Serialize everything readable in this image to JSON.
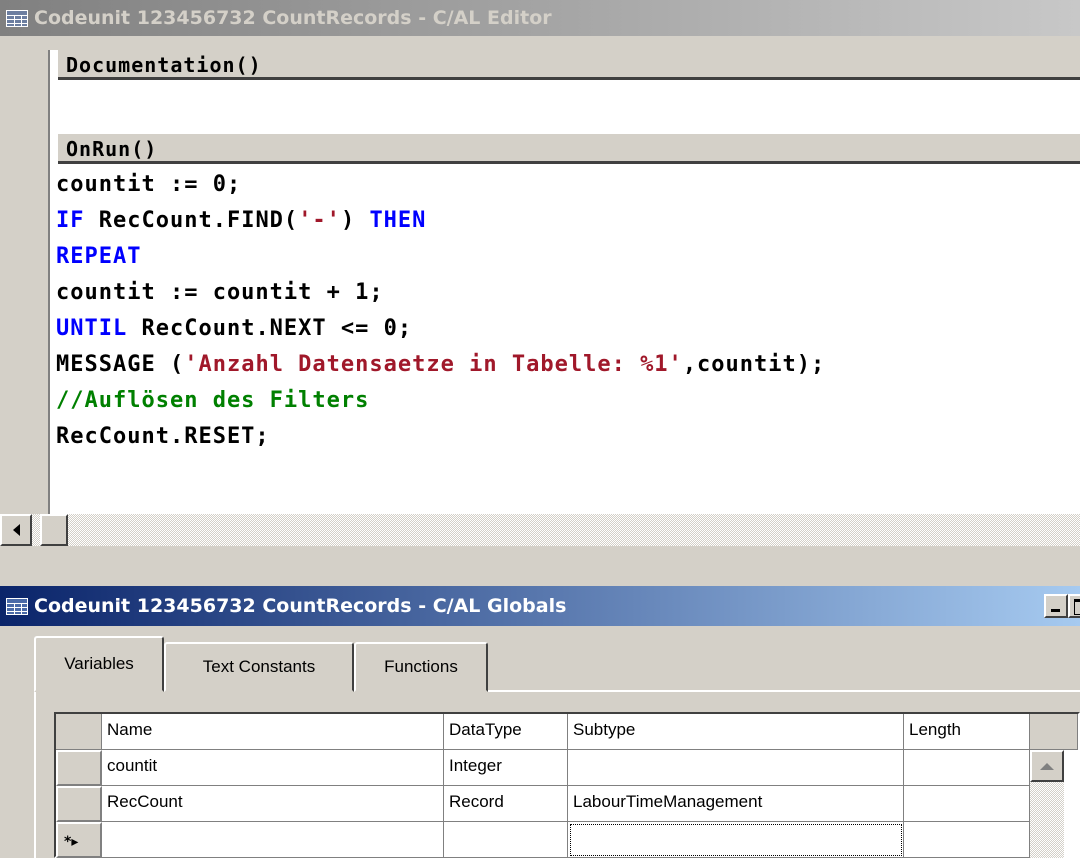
{
  "editor": {
    "title": "Codeunit 123456732 CountRecords - C/AL Editor",
    "triggers": [
      {
        "name": "Documentation()",
        "code": []
      },
      {
        "name": "OnRun()",
        "code": [
          [
            {
              "t": "countit := 0;",
              "c": "txt"
            }
          ],
          [
            {
              "t": "IF",
              "c": "kw"
            },
            {
              "t": " RecCount.FIND(",
              "c": "txt"
            },
            {
              "t": "'-'",
              "c": "str"
            },
            {
              "t": ") ",
              "c": "txt"
            },
            {
              "t": "THEN",
              "c": "kw"
            }
          ],
          [
            {
              "t": "REPEAT",
              "c": "kw"
            }
          ],
          [
            {
              "t": "countit := countit + 1;",
              "c": "txt"
            }
          ],
          [
            {
              "t": "UNTIL",
              "c": "kw"
            },
            {
              "t": " RecCount.NEXT <= 0;",
              "c": "txt"
            }
          ],
          [
            {
              "t": "MESSAGE (",
              "c": "txt"
            },
            {
              "t": "'Anzahl Datensaetze in Tabelle: %1'",
              "c": "str"
            },
            {
              "t": ",countit);",
              "c": "txt"
            }
          ],
          [
            {
              "t": "//Auflösen des Filters",
              "c": "cmt"
            }
          ],
          [
            {
              "t": "RecCount.RESET;",
              "c": "txt"
            }
          ]
        ]
      }
    ]
  },
  "globals": {
    "title": "Codeunit 123456732 CountRecords - C/AL Globals",
    "tabs": [
      "Variables",
      "Text Constants",
      "Functions"
    ],
    "active_tab": "Variables",
    "columns": [
      "Name",
      "DataType",
      "Subtype",
      "Length"
    ],
    "rows": [
      [
        "countit",
        "Integer",
        "",
        ""
      ],
      [
        "RecCount",
        "Record",
        "LabourTimeManagement",
        ""
      ]
    ],
    "new_row_marker": "*▸"
  },
  "icons": {
    "editor_title": "table-window-icon",
    "globals_title": "table-window-icon",
    "scroll_left": "arrow-left-icon",
    "scroll_up": "arrow-up-icon"
  },
  "colors": {
    "keyword": "#0000ff",
    "string": "#a0182a",
    "comment": "#008000",
    "active_title": "#0a246a",
    "inactive_title": "#808080"
  }
}
